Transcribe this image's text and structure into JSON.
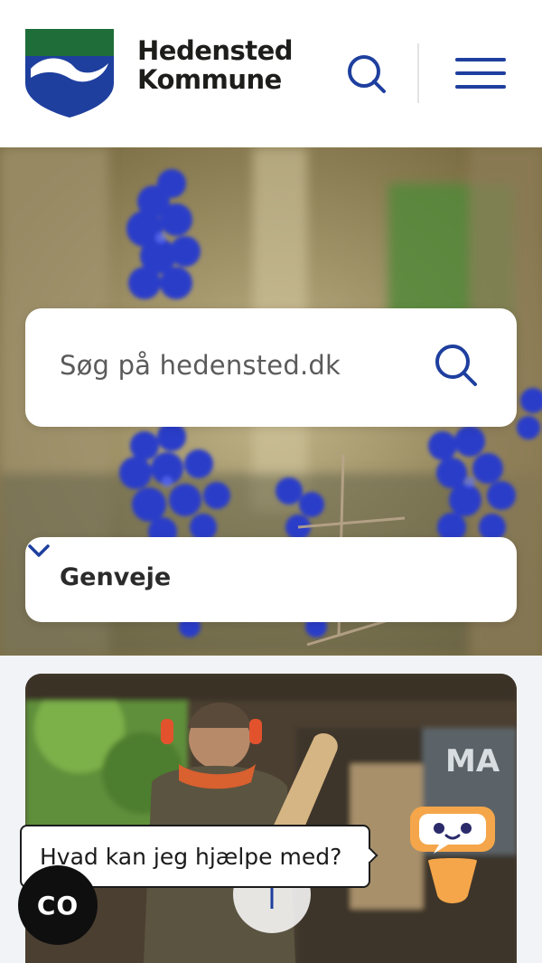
{
  "header": {
    "logo_line1": "Hedensted",
    "logo_line2": "Kommune",
    "search_icon": "search-icon",
    "menu_icon": "hamburger-menu-icon"
  },
  "hero": {
    "search": {
      "placeholder": "Søg på hedensted.dk",
      "icon": "search-icon"
    },
    "shortcuts": {
      "label": "Genveje",
      "icon": "chevron-down-icon"
    }
  },
  "chat": {
    "bubble_text": "Hvad kan jeg hjælpe med?",
    "launcher_text": "CO",
    "robot_icon": "chatbot-robot-icon"
  },
  "colors": {
    "brand_blue": "#1e3f9e",
    "logo_green": "#1f6e3a",
    "robot_orange": "#f5a64a"
  }
}
